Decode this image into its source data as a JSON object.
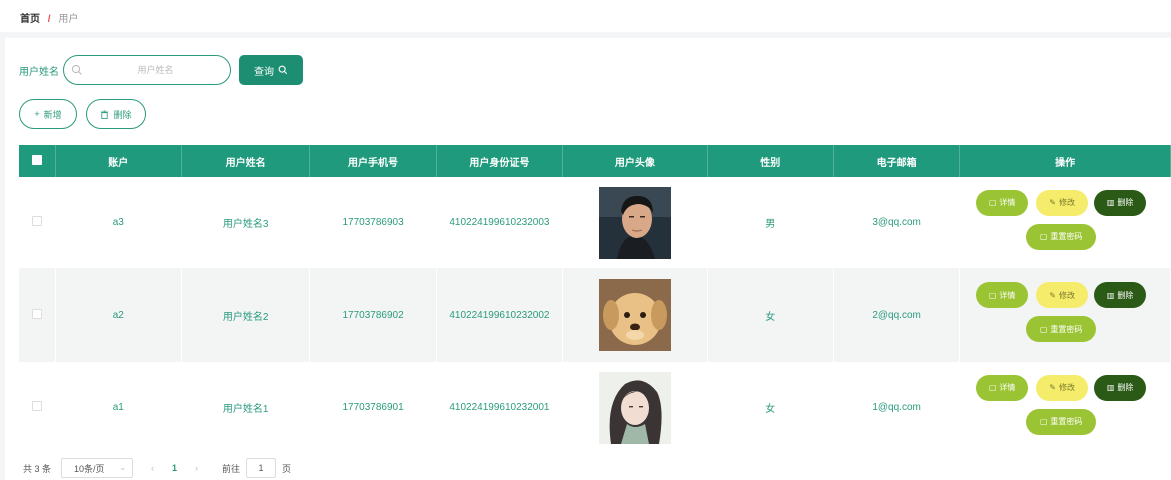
{
  "breadcrumb": {
    "home": "首页",
    "separator": "/",
    "current": "用户"
  },
  "search": {
    "label": "用户姓名",
    "placeholder": "用户姓名",
    "value": "",
    "button_label": "查询"
  },
  "actions": {
    "add_label": "新增",
    "delete_label": "删除"
  },
  "table": {
    "columns": [
      "账户",
      "用户姓名",
      "用户手机号",
      "用户身份证号",
      "用户头像",
      "性别",
      "电子邮箱",
      "操作"
    ],
    "rows": [
      {
        "account": "a3",
        "name": "用户姓名3",
        "phone": "17703786903",
        "id_card": "410224199610232003",
        "avatar": "male-portrait-photo",
        "gender": "男",
        "email": "3@qq.com"
      },
      {
        "account": "a2",
        "name": "用户姓名2",
        "phone": "17703786902",
        "id_card": "410224199610232002",
        "avatar": "puppy-photo",
        "gender": "女",
        "email": "2@qq.com"
      },
      {
        "account": "a1",
        "name": "用户姓名1",
        "phone": "17703786901",
        "id_card": "410224199610232001",
        "avatar": "anime-girl-photo",
        "gender": "女",
        "email": "1@qq.com"
      }
    ],
    "row_actions": {
      "detail": "详情",
      "edit": "修改",
      "delete": "删除",
      "reset_password": "重置密码"
    }
  },
  "pagination": {
    "total": "共 3 条",
    "page_size": "10条/页",
    "current_page": "1",
    "goto_label": "前往",
    "goto_value": "1",
    "page_unit": "页"
  },
  "colors": {
    "primary": "#1f9a7c",
    "detail": "#9bc434",
    "edit": "#f5ec6c",
    "delete": "#2b5a16",
    "breadcrumb_sep": "#e34d4d"
  }
}
